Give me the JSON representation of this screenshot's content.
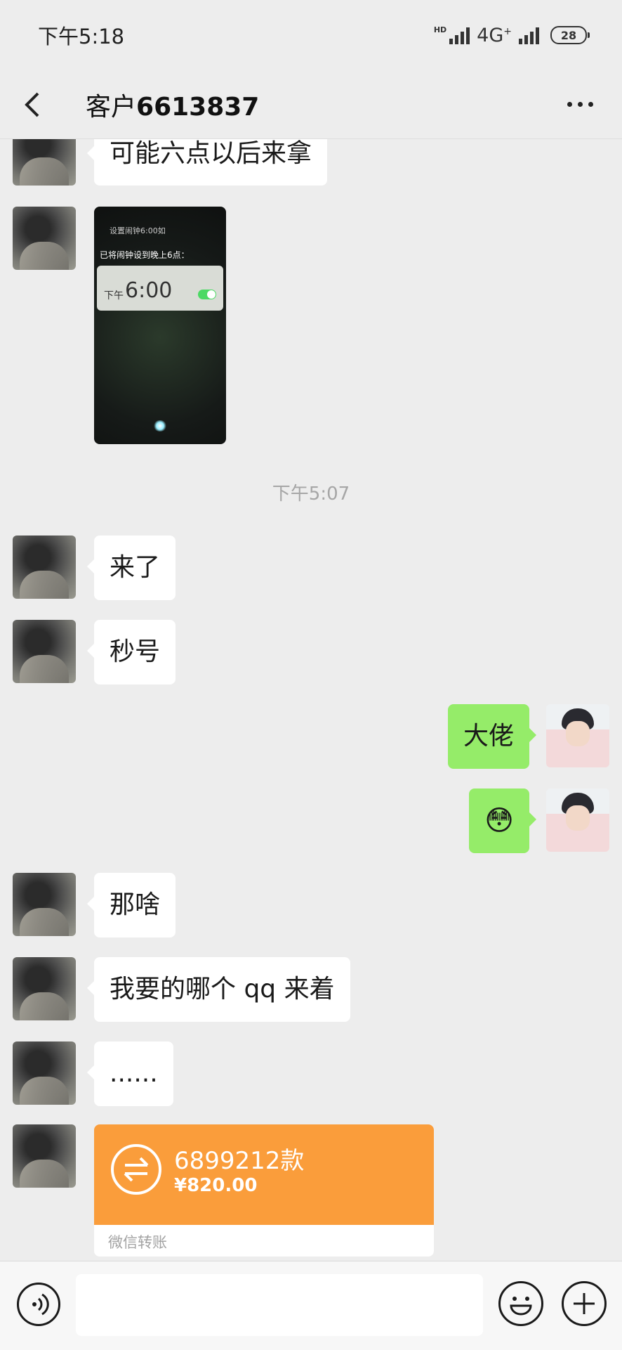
{
  "status": {
    "time": "下午5:18",
    "network": "4G",
    "network_sup": "+",
    "hd": "HD",
    "battery": "28"
  },
  "header": {
    "title_prefix": "客户",
    "title_number": "6613837"
  },
  "image_message": {
    "line1": "设置闹钟6:00如",
    "line2": "已将闹钟设到晚上6点：",
    "period": "下午",
    "time": "6:00"
  },
  "messages": {
    "m1": "可能六点以后来拿",
    "ts": "下午5:07",
    "m2": "来了",
    "m3": "秒号",
    "m4": "大佬",
    "m5": "😳",
    "m6": "那啥",
    "m7": "我要的哪个 qq 来着",
    "m8": "......"
  },
  "transfer": {
    "name": "6899212款",
    "amount": "¥820.00",
    "footer": "微信转账",
    "accent": "#fa9d3b"
  },
  "input": {
    "placeholder": ""
  },
  "colors": {
    "background": "#ededed",
    "bubble_right": "#95ec69",
    "bubble_left": "#ffffff"
  }
}
